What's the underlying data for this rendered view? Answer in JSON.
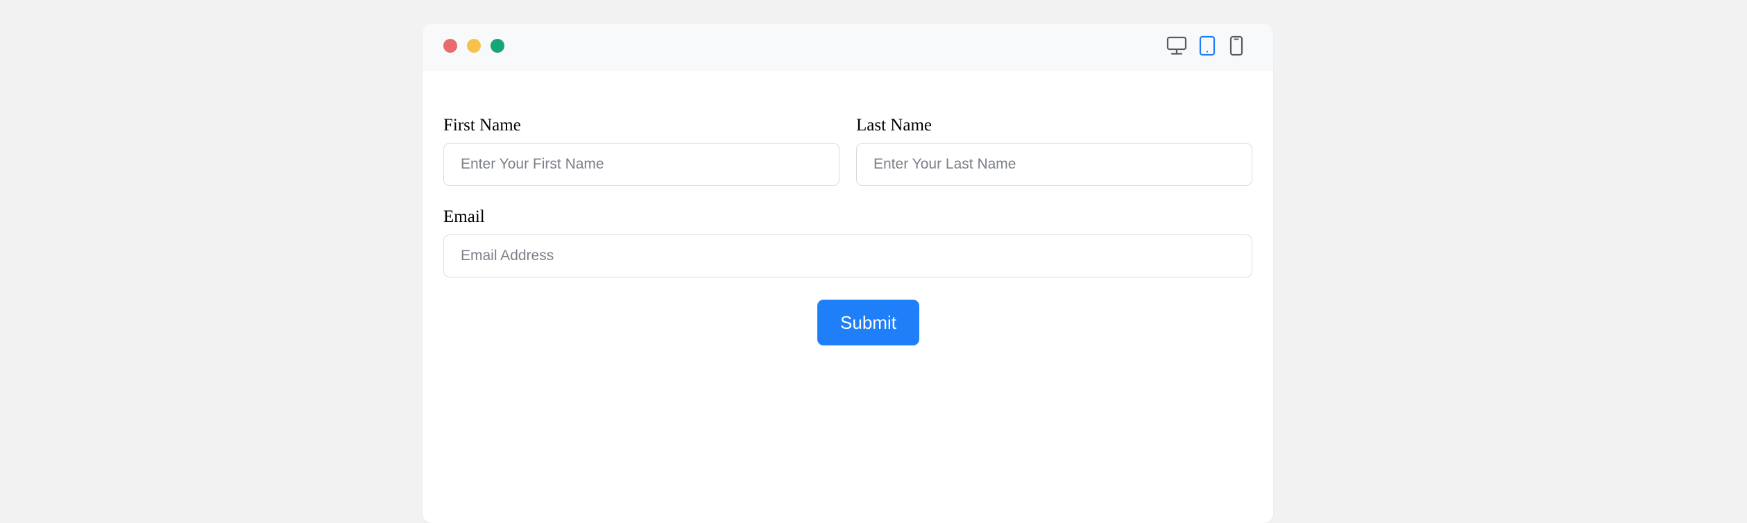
{
  "window": {
    "traffic_lights": [
      {
        "name": "close",
        "color": "#e86b6e"
      },
      {
        "name": "minimize",
        "color": "#f7c24c"
      },
      {
        "name": "maximize",
        "color": "#16a574"
      }
    ],
    "device_toggles": [
      {
        "icon": "desktop-icon",
        "active": false
      },
      {
        "icon": "tablet-icon",
        "active": true
      },
      {
        "icon": "mobile-icon",
        "active": false
      }
    ],
    "accent_color": "#1f7ff8"
  },
  "form": {
    "first_name": {
      "label": "First Name",
      "placeholder": "Enter Your First Name",
      "value": ""
    },
    "last_name": {
      "label": "Last Name",
      "placeholder": "Enter Your Last Name",
      "value": ""
    },
    "email": {
      "label": "Email",
      "placeholder": "Email Address",
      "value": ""
    },
    "submit_label": "Submit"
  }
}
